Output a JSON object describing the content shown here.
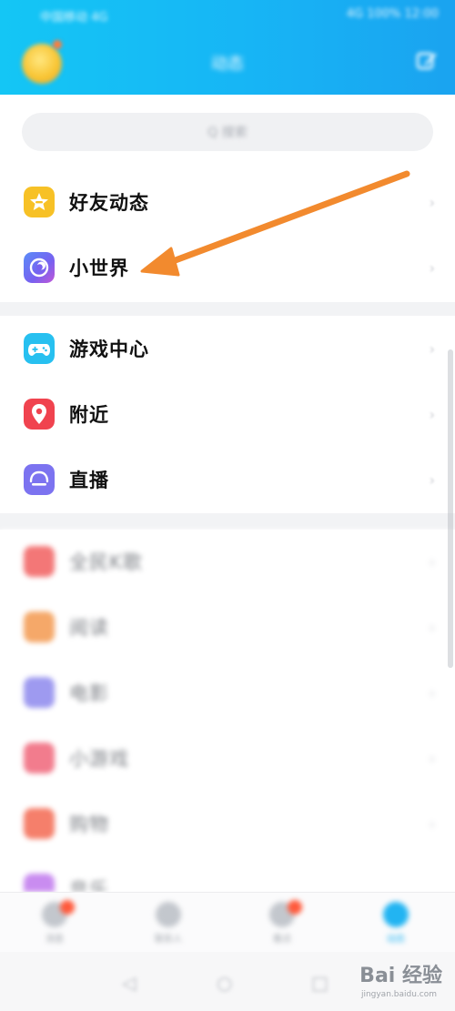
{
  "status_bar": {
    "left_text": "中国移动 4G",
    "right_text": "4G 100% 12:00"
  },
  "header": {
    "title": "动态"
  },
  "search": {
    "placeholder": "Q 搜索"
  },
  "section_1": {
    "items": [
      {
        "label": "好友动态",
        "icon": "star-icon",
        "color": "#f7c126"
      },
      {
        "label": "小世界",
        "icon": "planet-icon",
        "color": "#6a67f2"
      }
    ]
  },
  "section_2": {
    "items": [
      {
        "label": "游戏中心",
        "icon": "gamepad-icon",
        "color": "#27c0f0"
      },
      {
        "label": "附近",
        "icon": "location-pin-icon",
        "color": "#f0434f"
      },
      {
        "label": "直播",
        "icon": "live-icon",
        "color": "#7c73f0"
      }
    ]
  },
  "section_3": {
    "items": [
      {
        "label": "全民K歌",
        "icon": "karaoke-icon",
        "color": "#f37777"
      },
      {
        "label": "阅读",
        "icon": "book-icon",
        "color": "#f5a869"
      },
      {
        "label": "电影",
        "icon": "movie-icon",
        "color": "#9e9af0"
      },
      {
        "label": "小游戏",
        "icon": "mini-game-icon",
        "color": "#f27c8d"
      },
      {
        "label": "购物",
        "icon": "shopping-icon",
        "color": "#f57f6b"
      },
      {
        "label": "音乐",
        "icon": "music-icon",
        "color": "#c98cf0"
      }
    ]
  },
  "bottom_nav": {
    "items": [
      {
        "label": "消息",
        "icon": "message-icon",
        "badge": true
      },
      {
        "label": "联系人",
        "icon": "contacts-icon",
        "badge": false
      },
      {
        "label": "看点",
        "icon": "watch-icon",
        "badge": true
      },
      {
        "label": "动态",
        "icon": "star-icon",
        "badge": false,
        "active": true
      }
    ]
  },
  "system_nav": {
    "back": "◁",
    "home": "○",
    "recent": "□"
  },
  "watermark": {
    "brand": "Bai 经验",
    "url": "jingyan.baidu.com"
  },
  "colors": {
    "header_accent": "#17b5f5",
    "annotation_arrow": "#f28a2e"
  }
}
